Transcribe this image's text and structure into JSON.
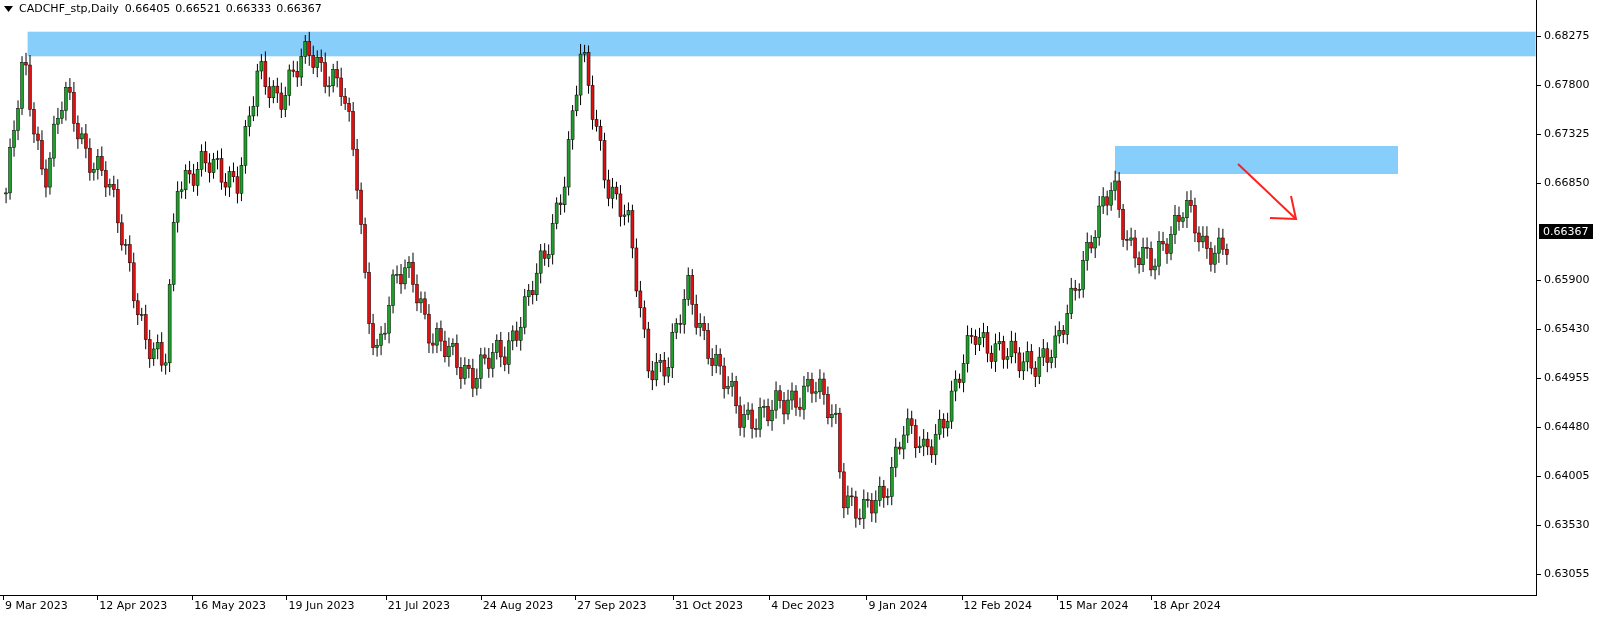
{
  "header": {
    "title": "CADCHF_stp,Daily",
    "ohlc": [
      "0.66405",
      "0.66521",
      "0.66333",
      "0.66367"
    ]
  },
  "price_axis": [
    "0.68275",
    "0.67800",
    "0.67325",
    "0.66850",
    "0.65900",
    "0.65430",
    "0.64955",
    "0.64480",
    "0.64005",
    "0.63530",
    "0.63055"
  ],
  "current_price": "0.66367",
  "time_axis": [
    "9 Mar 2023",
    "12 Apr 2023",
    "16 May 2023",
    "19 Jun 2023",
    "21 Jul 2023",
    "24 Aug 2023",
    "27 Sep 2023",
    "31 Oct 2023",
    "4 Dec 2023",
    "9 Jan 2024",
    "12 Feb 2024",
    "15 Mar 2024",
    "18 Apr 2024"
  ]
}
